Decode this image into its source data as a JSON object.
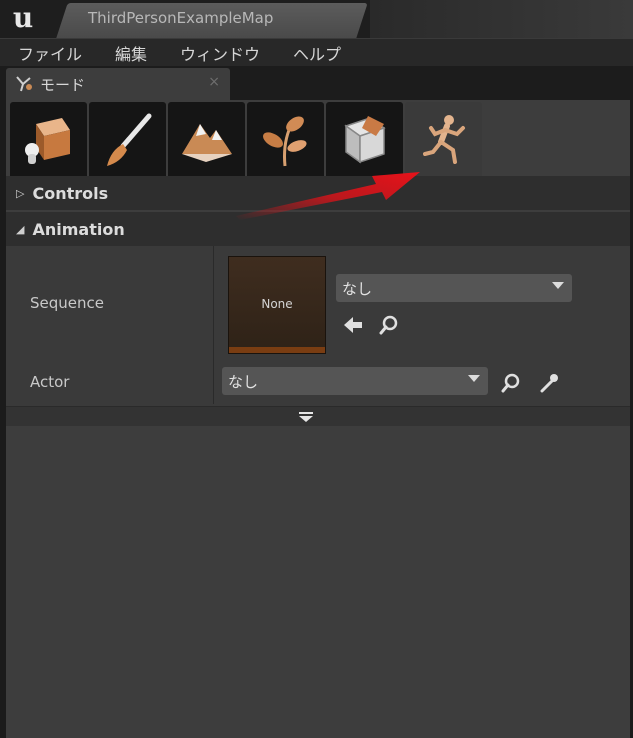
{
  "window": {
    "document_tab": "ThirdPersonExampleMap"
  },
  "menu": {
    "items": [
      "ファイル",
      "編集",
      "ウィンドウ",
      "ヘルプ"
    ]
  },
  "panel_tab": {
    "label": "モード",
    "close": "×"
  },
  "modes": {
    "items": [
      {
        "icon": "place-mode-icon"
      },
      {
        "icon": "paint-mode-icon"
      },
      {
        "icon": "landscape-mode-icon"
      },
      {
        "icon": "foliage-mode-icon"
      },
      {
        "icon": "geometry-mode-icon"
      },
      {
        "icon": "animation-mode-icon",
        "active": true
      }
    ]
  },
  "sections": {
    "controls": "Controls",
    "animation": "Animation"
  },
  "animation": {
    "sequence_label": "Sequence",
    "sequence_thumb": "None",
    "sequence_value": "なし",
    "actor_label": "Actor",
    "actor_value": "なし"
  },
  "colors": {
    "annotation_arrow": "#d4141a",
    "thumb_bar": "#7a3d12",
    "panel_bg": "#3d3d3d"
  }
}
